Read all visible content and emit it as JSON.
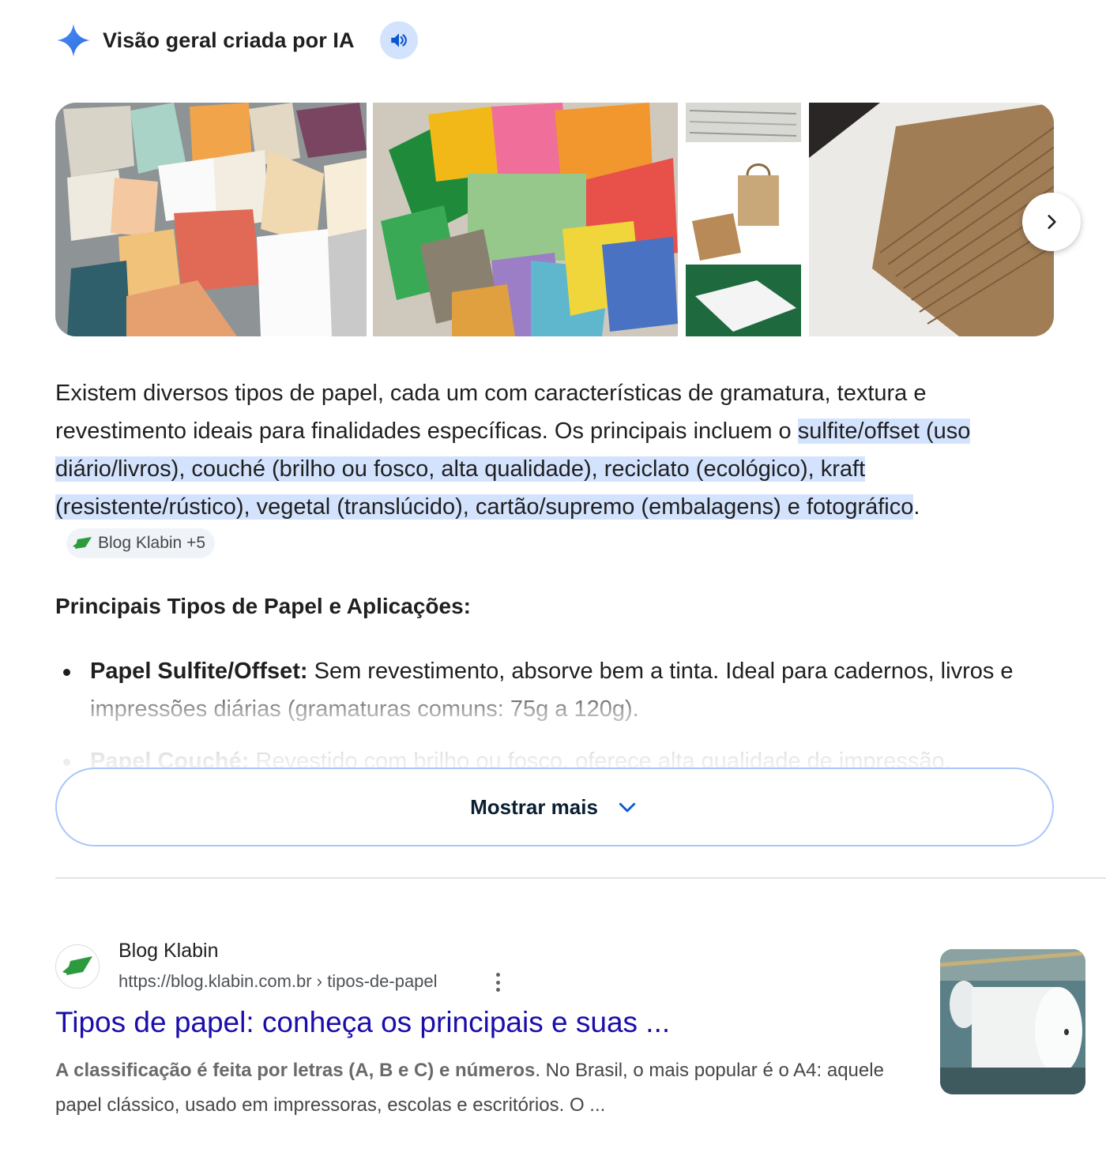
{
  "ai_overview": {
    "title": "Visão geral criada por IA",
    "accent_color": "#4285f4",
    "icons": {
      "spark": "sparkle-icon",
      "listen": "speaker-icon",
      "next": "chevron-right-icon"
    }
  },
  "summary": {
    "intro": "Existem diversos tipos de papel, cada um com características de gramatura, textura e revestimento ideais para finalidades específicas. Os principais incluem o ",
    "highlighted": "sulfite/offset (uso diário/livros), couché (brilho ou fosco, alta qualidade), reciclato (ecológico), kraft (resistente/rústico), vegetal (translúcido), cartão/supremo (embalagens) e fotográfico",
    "end": ".",
    "source_chip": "Blog Klabin +5",
    "highlight_color": "#d3e3fd"
  },
  "section": {
    "title": "Principais Tipos de Papel e Aplicações:",
    "bullets": [
      {
        "term": "Papel Sulfite/Offset:",
        "text": " Sem revestimento, absorve bem a tinta. Ideal para cadernos, livros e impressões diárias (gramaturas comuns: 75g a 120g)."
      },
      {
        "term": "Papel Couché:",
        "text": " Revestido com brilho ou fosco, oferece alta qualidade de impressão."
      }
    ]
  },
  "show_more": {
    "label": "Mostrar mais",
    "icon": "chevron-down-icon"
  },
  "result": {
    "site_name": "Blog Klabin",
    "url": "https://blog.klabin.com.br › tipos-de-papel",
    "title": "Tipos de papel: conheça os principais e suas ...",
    "snippet_bold": "A classificação é feita por letras (A, B e C) e números",
    "snippet_rest": ". No Brasil, o mais popular é o A4: aquele papel clássico, usado em impressoras, escolas e escritórios. O ...",
    "title_color": "#1a0dab"
  }
}
